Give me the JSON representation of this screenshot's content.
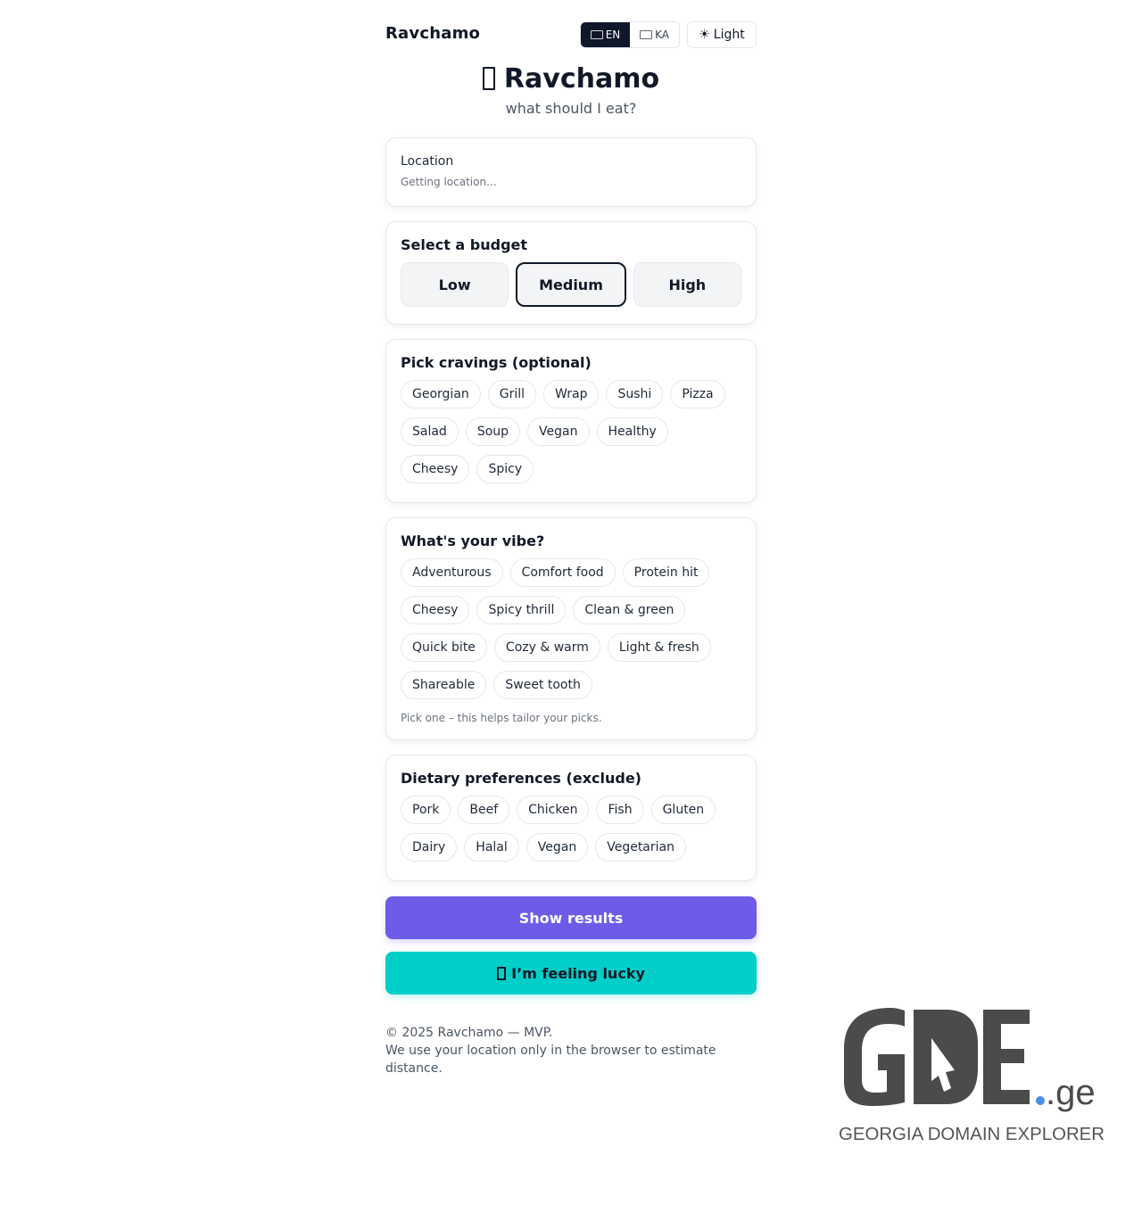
{
  "header": {
    "brand": "Ravchamo",
    "languages": [
      {
        "code": "EN",
        "active": true
      },
      {
        "code": "KA",
        "active": false
      }
    ],
    "theme_label": "Light",
    "theme_icon": "sun-icon"
  },
  "hero": {
    "title": "Ravchamo",
    "subtitle": "what should I eat?"
  },
  "location": {
    "label": "Location",
    "status": "Getting location..."
  },
  "budget": {
    "title": "Select a budget",
    "options": [
      "Low",
      "Medium",
      "High"
    ],
    "selected": "Medium"
  },
  "cravings": {
    "title": "Pick cravings (optional)",
    "items": [
      "Georgian",
      "Grill",
      "Wrap",
      "Sushi",
      "Pizza",
      "Salad",
      "Soup",
      "Vegan",
      "Healthy",
      "Cheesy",
      "Spicy"
    ]
  },
  "vibe": {
    "title": "What's your vibe?",
    "items": [
      "Adventurous",
      "Comfort food",
      "Protein hit",
      "Cheesy",
      "Spicy thrill",
      "Clean & green",
      "Quick bite",
      "Cozy & warm",
      "Light & fresh",
      "Shareable",
      "Sweet tooth"
    ],
    "hint": "Pick one – this helps tailor your picks."
  },
  "dietary": {
    "title": "Dietary preferences (exclude)",
    "items": [
      "Pork",
      "Beef",
      "Chicken",
      "Fish",
      "Gluten",
      "Dairy",
      "Halal",
      "Vegan",
      "Vegetarian"
    ]
  },
  "actions": {
    "show_results": "Show results",
    "feeling_lucky": "I’m feeling lucky"
  },
  "footer": {
    "copyright": "© 2025 Ravchamo — MVP.",
    "note": "We use your location only in the browser to estimate distance."
  },
  "watermark": {
    "logo_text": "GDE",
    "tld": ".ge",
    "tagline": "GEORGIA DOMAIN EXPLORER"
  },
  "colors": {
    "primary": "#6c5ce7",
    "accent": "#00cec9",
    "dark": "#0f172a",
    "border": "#e5e7eb"
  }
}
